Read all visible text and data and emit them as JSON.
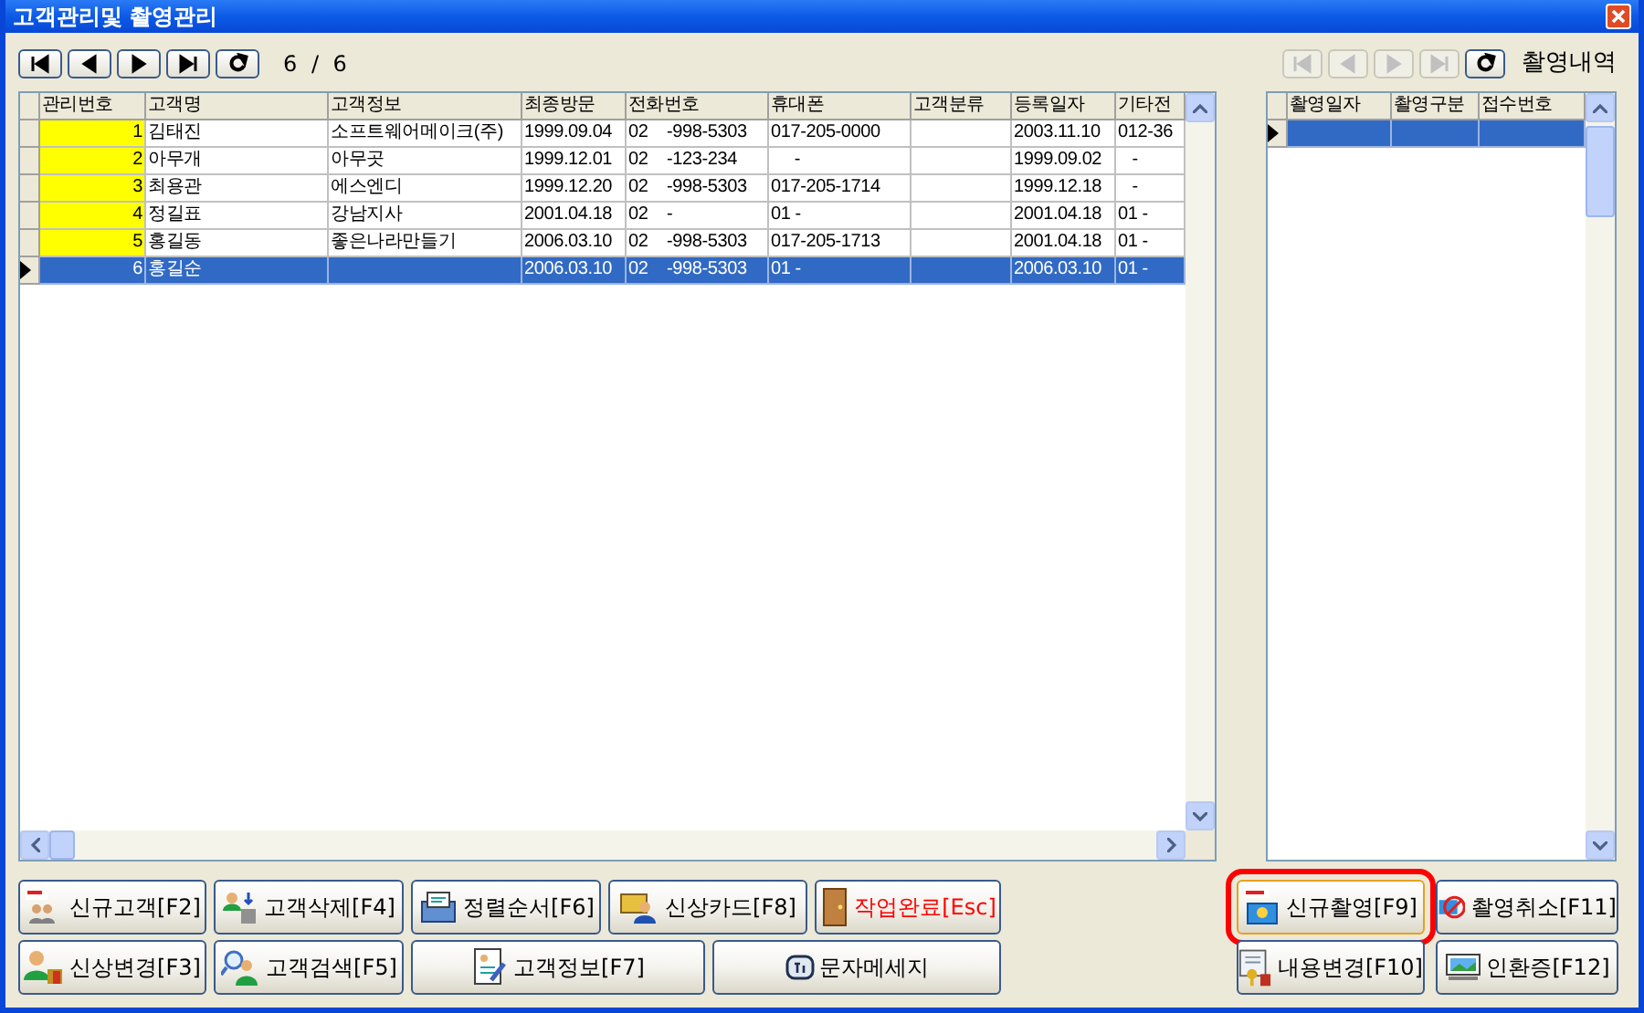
{
  "window": {
    "title": "고객관리및 촬영관리"
  },
  "record_counter": "6 / 6",
  "customer_table": {
    "columns": [
      "관리번호",
      "고객명",
      "고객정보",
      "최종방문",
      "전화번호",
      "휴대폰",
      "고객분류",
      "등록일자",
      "기타전"
    ],
    "rows": [
      {
        "cells": [
          "1",
          "김태진",
          "소프트웨어메이크(주)",
          "1999.09.04",
          "02    -998-5303",
          "017-205-0000",
          "",
          "2003.11.10",
          "012-36"
        ],
        "selected": false
      },
      {
        "cells": [
          "2",
          "아무개",
          "아무곳",
          "1999.12.01",
          "02    -123-234",
          "     -",
          "",
          "1999.09.02",
          "   -"
        ],
        "selected": false
      },
      {
        "cells": [
          "3",
          "최용관",
          "에스엔디",
          "1999.12.20",
          "02    -998-5303",
          "017-205-1714",
          "",
          "1999.12.18",
          "   -"
        ],
        "selected": false
      },
      {
        "cells": [
          "4",
          "정길표",
          "강남지사",
          "2001.04.18",
          "02    -",
          "01 -",
          "",
          "2001.04.18",
          "01 -"
        ],
        "selected": false
      },
      {
        "cells": [
          "5",
          "홍길동",
          "좋은나라만들기",
          "2006.03.10",
          "02    -998-5303",
          "017-205-1713",
          "",
          "2001.04.18",
          "01 -"
        ],
        "selected": false
      },
      {
        "cells": [
          "6",
          "홍길순",
          "",
          "2006.03.10",
          "02    -998-5303",
          "01 -",
          "",
          "2006.03.10",
          "01 -"
        ],
        "selected": true
      }
    ]
  },
  "shoot_panel": {
    "title": "촬영내역",
    "columns": [
      "촬영일자",
      "촬영구분",
      "접수번호"
    ],
    "rows": [
      {
        "selected": true
      }
    ]
  },
  "left_buttons": [
    {
      "label": "신규고객[F2]",
      "warning": false
    },
    {
      "label": "고객삭제[F4]",
      "warning": false
    },
    {
      "label": "정렬순서[F6]",
      "warning": false
    },
    {
      "label": "신상카드[F8]",
      "warning": false
    },
    {
      "label": "작업완료[Esc]",
      "warning": true
    },
    {
      "label": "신상변경[F3]",
      "warning": false
    },
    {
      "label": "고객검색[F5]",
      "warning": false
    },
    {
      "label": "고객정보[F7]",
      "warning": false
    },
    {
      "label": "문자메세지",
      "warning": false
    }
  ],
  "right_buttons": [
    {
      "label": "신규촬영[F9]",
      "highlighted": true
    },
    {
      "label": "촬영취소[F11]",
      "highlighted": false
    },
    {
      "label": "내용변경[F10]",
      "highlighted": false
    },
    {
      "label": "인환증[F12]",
      "highlighted": false
    }
  ]
}
